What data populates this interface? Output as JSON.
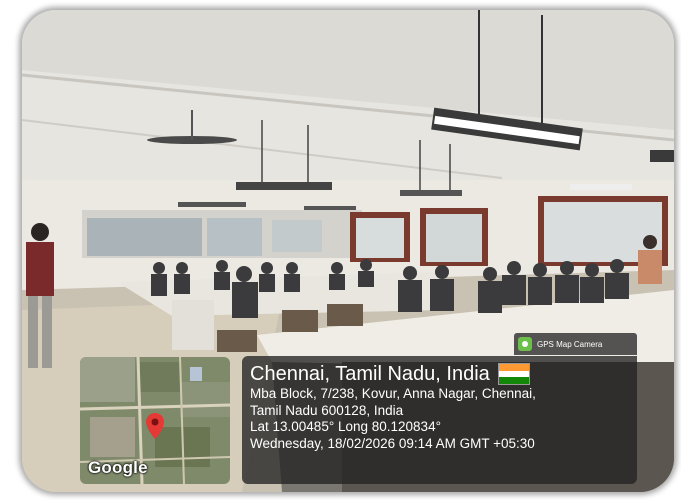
{
  "overlay": {
    "app_label": "GPS Map Camera",
    "city": "Chennai, Tamil Nadu, India",
    "address_line1": "Mba Block, 7/238, Kovur, Anna Nagar, Chennai,",
    "address_line2": "Tamil Nadu 600128, India",
    "coordinates": "Lat 13.00485° Long 80.120834°",
    "datetime": "Wednesday, 18/02/2026 09:14 AM GMT +05:30",
    "map_brand": "Google"
  },
  "colors": {
    "flag_saffron": "#ff9933",
    "flag_white": "#ffffff",
    "flag_green": "#138808",
    "map_pin": "#e53935"
  },
  "icons": [
    "camera-app-icon",
    "india-flag-icon",
    "map-pin-icon"
  ]
}
